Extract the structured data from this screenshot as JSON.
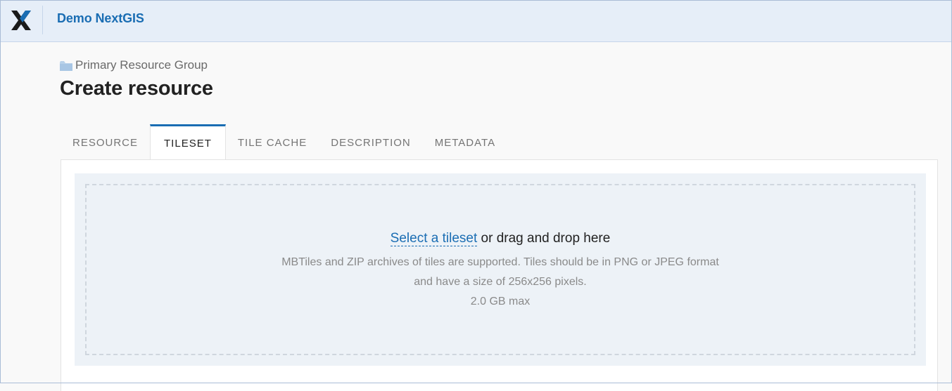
{
  "header": {
    "app_title": "Demo NextGIS",
    "logo_icon": "nextgis-x-logo",
    "accent_color": "#1a6db3"
  },
  "breadcrumb": {
    "icon": "folder-icon",
    "label": "Primary Resource Group"
  },
  "page": {
    "title": "Create resource"
  },
  "tabs": [
    {
      "label": "RESOURCE",
      "active": false
    },
    {
      "label": "TILESET",
      "active": true
    },
    {
      "label": "TILE CACHE",
      "active": false
    },
    {
      "label": "DESCRIPTION",
      "active": false
    },
    {
      "label": "METADATA",
      "active": false
    }
  ],
  "upload": {
    "select_link": "Select a tileset",
    "drop_text": " or drag and drop here",
    "help_line1": "MBTiles and ZIP archives of tiles are supported. Tiles should be in PNG or JPEG format",
    "help_line2": "and have a size of 256x256 pixels.",
    "max_size": "2.0 GB max"
  }
}
